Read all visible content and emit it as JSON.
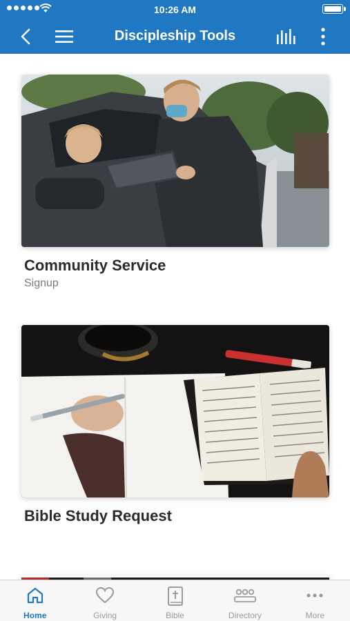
{
  "status_bar": {
    "time": "10:26 AM"
  },
  "nav": {
    "title": "Discipleship Tools"
  },
  "cards": [
    {
      "title": "Community Service",
      "subtitle": "Signup",
      "image": "photo-volunteer-at-car-window"
    },
    {
      "title": "Bible Study Request",
      "subtitle": "",
      "image": "photo-notebook-and-open-bible"
    }
  ],
  "tabs": [
    {
      "label": "Home",
      "icon": "home-icon",
      "active": true
    },
    {
      "label": "Giving",
      "icon": "heart-icon",
      "active": false
    },
    {
      "label": "Bible",
      "icon": "bible-icon",
      "active": false
    },
    {
      "label": "Directory",
      "icon": "people-icon",
      "active": false
    },
    {
      "label": "More",
      "icon": "ellipsis-icon",
      "active": false
    }
  ],
  "colors": {
    "brand": "#1f78c1",
    "tab_inactive": "#9a9a9a",
    "title_text": "#2a2a2a",
    "subtitle_text": "#7a7a7a"
  }
}
